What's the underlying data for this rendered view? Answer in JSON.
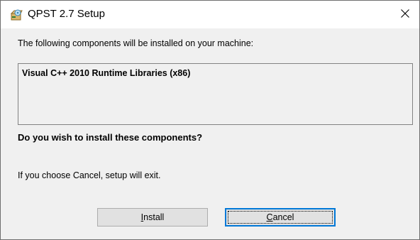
{
  "window": {
    "title": "QPST 2.7 Setup",
    "close_glyph": "✕"
  },
  "dialog": {
    "intro": "The following components will be installed on your machine:",
    "components": [
      "Visual C++ 2010 Runtime Libraries (x86)"
    ],
    "question": "Do you wish to install these components?",
    "exit_note": "If you choose Cancel, setup will exit."
  },
  "buttons": {
    "install": {
      "mnemonic": "I",
      "rest": "nstall"
    },
    "cancel": {
      "mnemonic": "C",
      "rest": "ancel"
    }
  },
  "colors": {
    "focus_border": "#0078d7",
    "button_face": "#e1e1e1",
    "dialog_background": "#f0f0f0"
  },
  "icons": {
    "app": "setup-installer-icon",
    "close": "close-icon"
  }
}
